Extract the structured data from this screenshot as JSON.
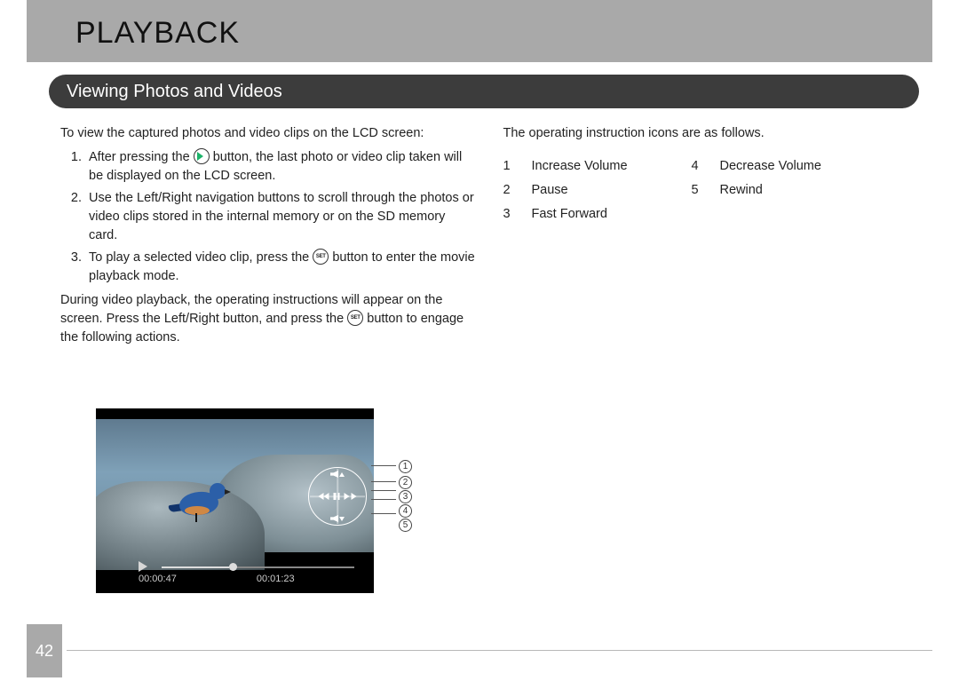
{
  "title": "PLAYBACK",
  "section": "Viewing Photos and Videos",
  "left": {
    "intro": "To view the captured photos and video clips on the LCD screen:",
    "step1_a": "After pressing the ",
    "step1_b": " button, the last photo or video clip taken will be displayed on the LCD screen.",
    "step2": "Use the Left/Right navigation buttons to scroll through the photos or video clips stored in the internal memory or on the SD memory card.",
    "step3_a": "To play a selected video clip, press the ",
    "step3_b": " button to enter the movie playback mode.",
    "para2_a": "During video playback, the operating instructions will appear on the screen. Press the Left/Right button, and press the ",
    "para2_b": " button to engage the following actions.",
    "set_label": "SET"
  },
  "right": {
    "intro": "The operating instruction icons are as follows.",
    "items": [
      {
        "n": "1",
        "label": "Increase Volume"
      },
      {
        "n": "2",
        "label": "Pause"
      },
      {
        "n": "3",
        "label": "Fast Forward"
      },
      {
        "n": "4",
        "label": "Decrease Volume"
      },
      {
        "n": "5",
        "label": "Rewind"
      }
    ]
  },
  "lcd": {
    "elapsed": "00:00:47",
    "total": "00:01:23",
    "callouts": [
      "1",
      "2",
      "3",
      "4",
      "5"
    ]
  },
  "page_number": "42"
}
